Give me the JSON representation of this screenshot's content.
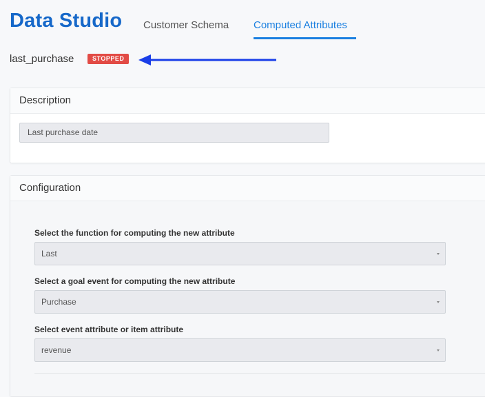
{
  "header": {
    "brand": "Data Studio",
    "tabs": [
      {
        "label": "Customer Schema",
        "active": false
      },
      {
        "label": "Computed Attributes",
        "active": true
      }
    ]
  },
  "attribute": {
    "name": "last_purchase",
    "status": "STOPPED",
    "status_color": "#e24b45"
  },
  "description_card": {
    "title": "Description",
    "value": "Last purchase date"
  },
  "configuration_card": {
    "title": "Configuration",
    "fields": [
      {
        "label": "Select the function for computing the new attribute",
        "value": "Last"
      },
      {
        "label": "Select a goal event for computing the new attribute",
        "value": "Purchase"
      },
      {
        "label": "Select event attribute or item attribute",
        "value": "revenue"
      }
    ]
  },
  "colors": {
    "accent": "#1668c9",
    "tab_active": "#1a7fe0",
    "arrow": "#1a3ee8"
  },
  "icons": {
    "annotation": "arrow-left-icon",
    "select_caret": "caret-down-icon"
  }
}
